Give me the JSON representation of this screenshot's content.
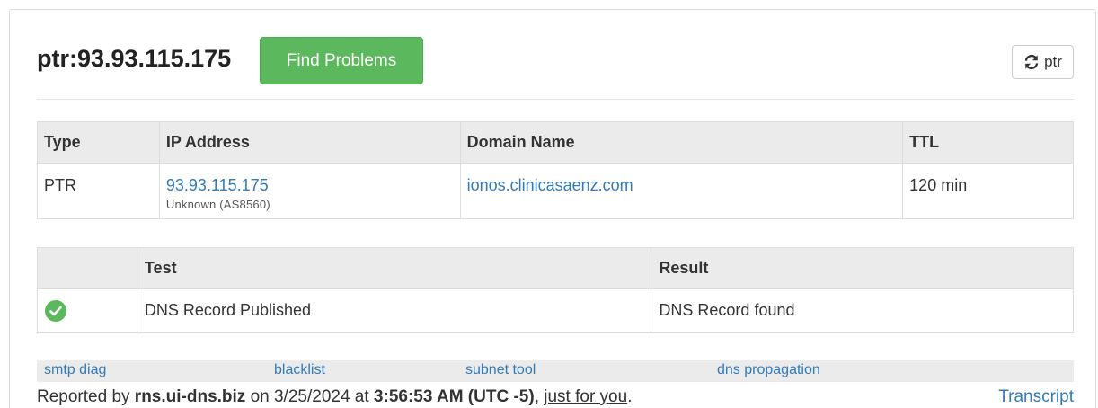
{
  "header": {
    "title": "ptr:93.93.115.175",
    "find_button": "Find Problems",
    "refresh_label": "ptr"
  },
  "record_table": {
    "columns": [
      "Type",
      "IP Address",
      "Domain Name",
      "TTL"
    ],
    "rows": [
      {
        "type": "PTR",
        "ip": "93.93.115.175",
        "ip_owner": "Unknown (AS8560)",
        "domain": "ionos.clinicasaenz.com",
        "ttl": "120 min"
      }
    ]
  },
  "test_table": {
    "columns": [
      "",
      "Test",
      "Result"
    ],
    "rows": [
      {
        "status": "pass",
        "test": "DNS Record Published",
        "result": "DNS Record found"
      }
    ]
  },
  "tools": [
    "smtp diag",
    "blacklist",
    "subnet tool",
    "dns propagation"
  ],
  "footer": {
    "prefix": "Reported by ",
    "server": "rns.ui-dns.biz",
    "on": " on 3/25/2024 at ",
    "time": "3:56:53 AM (UTC -5)",
    "comma": ", ",
    "just_for_you": "just for you",
    "period": ".",
    "transcript": "Transcript"
  },
  "colors": {
    "success_green": "#5cb85c",
    "link_blue": "#337ab7",
    "header_gray": "#ebebeb"
  }
}
